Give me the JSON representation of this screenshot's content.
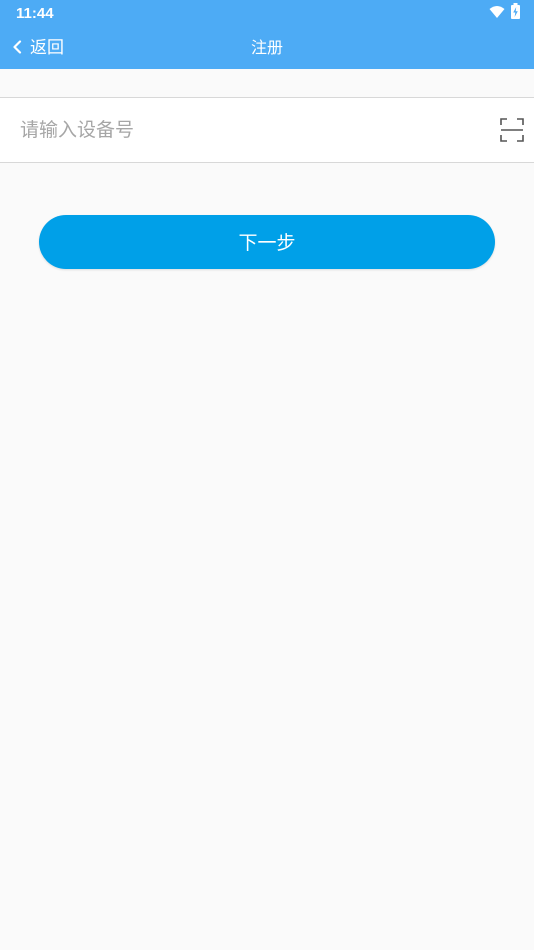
{
  "status_bar": {
    "time": "11:44",
    "icons": [
      "wifi-icon",
      "battery-charging-icon"
    ]
  },
  "header": {
    "back_label": "返回",
    "title": "注册",
    "background_color": "#4dabf5"
  },
  "form": {
    "device_input": {
      "value": "",
      "placeholder": "请输入设备号"
    },
    "scan_icon": "scan-icon"
  },
  "actions": {
    "next_label": "下一步",
    "button_color": "#00a0e8"
  }
}
